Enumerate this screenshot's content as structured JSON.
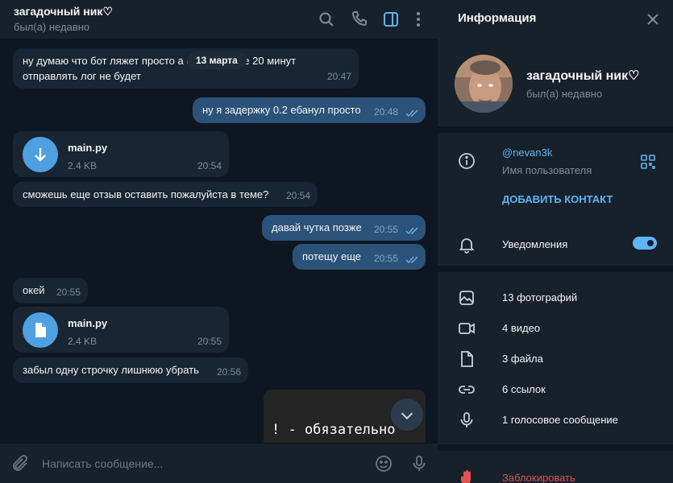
{
  "chat": {
    "title": "загадочный ник♡",
    "status": "был(а) недавно",
    "date_pill": "13 марта",
    "messages": [
      {
        "dir": "in",
        "text_line1": "ну думаю что бот ляжет просто а если каждые 20 минут",
        "text_line2": "отправлять лог не будет",
        "time": "20:47"
      },
      {
        "dir": "out",
        "text": "ну я задержку 0.2 ебанул просто",
        "time": "20:48"
      },
      {
        "dir": "in",
        "file_name": "main.py",
        "file_size": "2.4 KB",
        "time": "20:54",
        "icon": "download-icon"
      },
      {
        "dir": "in",
        "text": "сможешь еще отзыв оставить пожалуйста в теме?",
        "time": "20:54"
      },
      {
        "dir": "out",
        "text": "давай чутка позже",
        "time": "20:55"
      },
      {
        "dir": "out",
        "text": "потещу еще",
        "time": "20:55"
      },
      {
        "dir": "in",
        "text": "окей",
        "time": "20:55"
      },
      {
        "dir": "in",
        "file_name": "main.py",
        "file_size": "2.4 KB",
        "time": "20:55",
        "icon": "document-icon"
      },
      {
        "dir": "in",
        "text": "забыл одну строчку лишнюю убрать",
        "time": "20:56"
      }
    ],
    "image_caption": "! - обязательно"
  },
  "composer": {
    "placeholder": "Написать сообщение..."
  },
  "info": {
    "title": "Информация",
    "name": "загадочный ник♡",
    "status": "был(а) недавно",
    "username": "@nevan3k",
    "username_label": "Имя пользователя",
    "add_contact": "ДОБАВИТЬ КОНТАКТ",
    "notifications_label": "Уведомления",
    "notifications_on": true,
    "media": [
      {
        "label": "13 фотографий",
        "icon": "photo-icon"
      },
      {
        "label": "4 видео",
        "icon": "video-icon"
      },
      {
        "label": "3 файла",
        "icon": "file-icon"
      },
      {
        "label": "6 ссылок",
        "icon": "link-icon"
      },
      {
        "label": "1 голосовое сообщение",
        "icon": "microphone-icon"
      }
    ],
    "block_label": "Заблокировать"
  },
  "colors": {
    "accent": "#5eb5f7",
    "incoming_bubble": "#182533",
    "outgoing_bubble": "#2b5278",
    "danger": "#e0524f"
  }
}
